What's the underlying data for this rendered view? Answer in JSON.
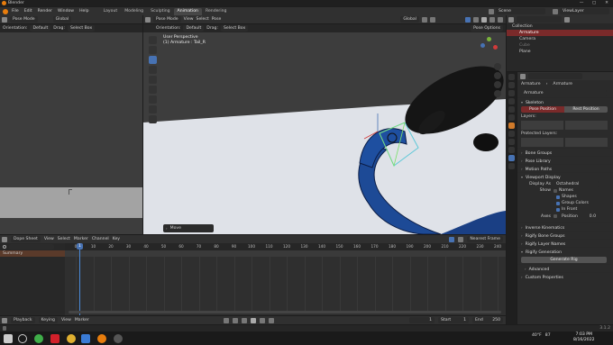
{
  "window": {
    "title": "Blender",
    "controls": [
      "—",
      "▢",
      "✕"
    ]
  },
  "menu": [
    "File",
    "Edit",
    "Render",
    "Window",
    "Help"
  ],
  "workspace_tabs": [
    "Layout",
    "Modeling",
    "Sculpting",
    "Animation",
    "Rendering"
  ],
  "active_workspace": "Animation",
  "scene": "Scene",
  "view_layer": "ViewLayer",
  "left_header": {
    "mode": "Pose Mode",
    "transform": "Global",
    "orientation_label": "Orientation:",
    "orientation_value": "Default",
    "drag_label": "Drag:",
    "drag_value": "Select Box"
  },
  "viewport_header": {
    "mode": "Pose Mode",
    "menus": [
      "View",
      "Select",
      "Pose"
    ],
    "transform": "Global",
    "orientation_label": "Orientation:",
    "orientation_value": "Default",
    "drag_label": "Drag:",
    "drag_value": "Select Box",
    "pose_options": "Pose Options"
  },
  "viewport": {
    "perspective": "User Perspective",
    "object": "(1) Armature : Tail_R",
    "status_left": "Move"
  },
  "outliner": {
    "items": [
      {
        "label": "Collection",
        "indent": 0
      },
      {
        "label": "Armature",
        "indent": 1,
        "selected": true
      },
      {
        "label": "Camera",
        "indent": 1
      },
      {
        "label": "Cube",
        "indent": 1
      },
      {
        "label": "Plane",
        "indent": 1
      }
    ]
  },
  "properties": {
    "breadcrumb": [
      "Armature",
      "Armature"
    ],
    "name_field": "Armature",
    "skeleton_label": "Skeleton",
    "pose_position": "Pose Position",
    "rest_position": "Rest Position",
    "layers_label": "Layers:",
    "protected_layers_label": "Protected Layers:",
    "sections": [
      "Bone Groups",
      "Pose Library",
      "Motion Paths"
    ],
    "viewport_display_label": "Viewport Display",
    "display_as_label": "Display As",
    "display_as_value": "Octahedral",
    "show_label": "Show",
    "show_options": [
      "Names",
      "Shapes",
      "Group Colors",
      "In Front"
    ],
    "axes_label": "Axes",
    "axes_position_label": "Position",
    "axes_position_value": "0.0",
    "more_sections": [
      "Inverse Kinematics",
      "Rigify Bone Groups",
      "Rigify Layer Names",
      "Rigify Generation"
    ],
    "generate_button": "Generate Rig",
    "advanced_label": "Advanced",
    "custom_props_label": "Custom Properties"
  },
  "dopesheet_header": {
    "editor": "Dope Sheet",
    "menus": [
      "View",
      "Select",
      "Marker",
      "Channel",
      "Key"
    ],
    "nearest_frame": "Nearest Frame"
  },
  "dopesheet": {
    "channel": "Summary",
    "current_frame": "1",
    "ticks": [
      "0",
      "10",
      "20",
      "30",
      "40",
      "50",
      "60",
      "70",
      "80",
      "90",
      "100",
      "110",
      "120",
      "130",
      "140",
      "150",
      "160",
      "170",
      "180",
      "190",
      "200",
      "210",
      "220",
      "230",
      "240",
      "250"
    ]
  },
  "playback_bar": {
    "playback": "Playback",
    "keying": "Keying",
    "menus": [
      "View",
      "Marker"
    ],
    "frame_value": "1",
    "start_label": "Start",
    "start_value": "1",
    "end_label": "End",
    "end_value": "250"
  },
  "status_bar": {
    "version": "3.1.2"
  },
  "taskbar": {
    "time": "7:03 PM",
    "date": "8/16/2022",
    "temp": "40°F",
    "battery": "87"
  }
}
